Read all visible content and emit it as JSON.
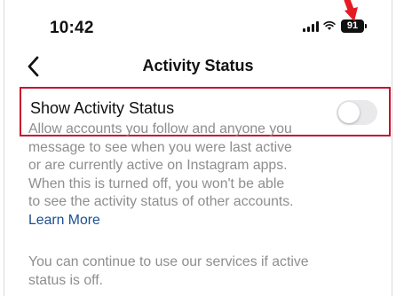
{
  "status_bar": {
    "time": "10:42",
    "battery_level": "91",
    "signal_icon": "cellular-signal-icon",
    "wifi_icon": "wifi-icon",
    "battery_icon": "battery-icon"
  },
  "annotation": {
    "arrow_color": "#e31b23"
  },
  "header": {
    "back_icon": "chevron-left-icon",
    "title": "Activity Status"
  },
  "setting": {
    "label": "Show Activity Status",
    "toggle_on": false,
    "highlight_color": "#c8102e"
  },
  "description": {
    "text": "Allow accounts you follow and anyone you message to see when you were last active or are currently active on Instagram apps. When this is turned off, you won't be able to see the activity status of other accounts.",
    "link_text": "Learn More",
    "link_color": "#1a4f91"
  },
  "footer": {
    "text": "You can continue to use our services if active status is off."
  }
}
